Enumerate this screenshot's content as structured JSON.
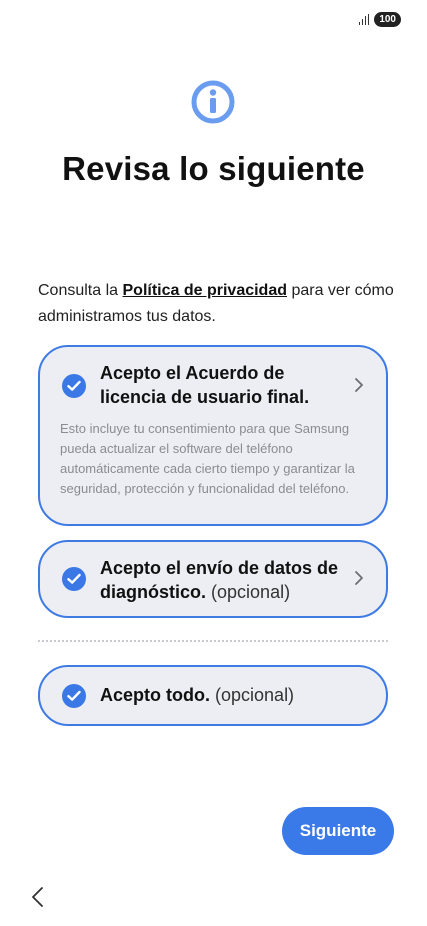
{
  "status_bar": {
    "battery": "100",
    "signal_icon": "signal-bars-icon"
  },
  "header": {
    "icon": "info-icon",
    "title": "Revisa lo siguiente"
  },
  "intro": {
    "prefix": "Consulta la ",
    "link": "Política de privacidad",
    "suffix": " para ver cómo administramos tus datos."
  },
  "options": [
    {
      "checked": true,
      "title": "Acepto el Acuerdo de licencia de usuario final.",
      "optional_label": "",
      "description": "Esto incluye tu consentimiento para que Samsung pueda actualizar el software del teléfono automáticamente cada cierto tiempo y garantizar la seguridad, protección y funcionalidad del teléfono.",
      "has_chevron": true
    },
    {
      "checked": true,
      "title": "Acepto el envío de datos de diagnóstico.",
      "optional_label": "(opcional)",
      "has_chevron": true
    },
    {
      "checked": true,
      "title": "Acepto todo.",
      "optional_label": "(opcional)",
      "has_chevron": false
    }
  ],
  "footer": {
    "next_label": "Siguiente",
    "back_icon": "chevron-left-icon"
  },
  "colors": {
    "accent": "#3a7ae8",
    "card_background": "#eceef3",
    "info_icon": "#6a9cf0"
  }
}
